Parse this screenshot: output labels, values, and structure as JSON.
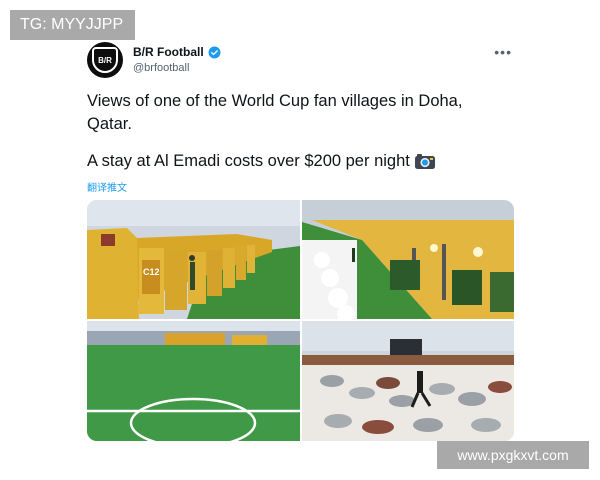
{
  "overlay": {
    "tg_label": "TG: MYYJJPP",
    "watermark": "www.pxgkxvt.com"
  },
  "tweet": {
    "display_name": "B/R Football",
    "handle": "@brfootball",
    "avatar_text": "B/R",
    "text_line1": "Views of one of the World Cup fan villages in Doha, Qatar.",
    "text_line2": "A stay at Al Emadi costs over $200 per night",
    "translate_label": "翻译推文",
    "container_label": "C12",
    "more_label": "•••"
  },
  "colors": {
    "accent": "#1d9bf0",
    "text": "#0f1419",
    "muted": "#536471",
    "overlay_bg": "#a9a9a9"
  },
  "icons": {
    "verified": "verified-badge-icon",
    "camera": "camera-icon",
    "more": "more-icon"
  }
}
